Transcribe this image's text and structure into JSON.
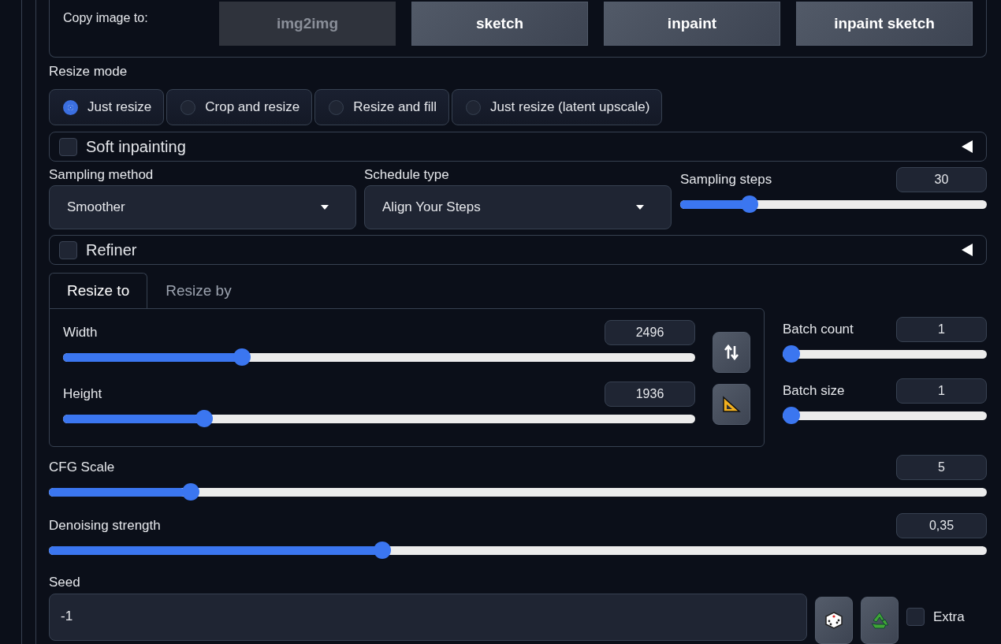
{
  "copy_panel": {
    "label": "Copy image to:",
    "buttons": [
      {
        "label": "img2img",
        "disabled": true
      },
      {
        "label": "sketch",
        "disabled": false
      },
      {
        "label": "inpaint",
        "disabled": false
      },
      {
        "label": "inpaint sketch",
        "disabled": false
      }
    ]
  },
  "resize_mode": {
    "label": "Resize mode",
    "options": [
      {
        "label": "Just resize",
        "selected": true
      },
      {
        "label": "Crop and resize",
        "selected": false
      },
      {
        "label": "Resize and fill",
        "selected": false
      },
      {
        "label": "Just resize (latent upscale)",
        "selected": false
      }
    ]
  },
  "soft_inpainting": {
    "label": "Soft inpainting",
    "checked": false,
    "expanded": false
  },
  "sampling_method": {
    "label": "Sampling method",
    "value": "Smoother"
  },
  "schedule_type": {
    "label": "Schedule type",
    "value": "Align Your Steps"
  },
  "sampling_steps": {
    "label": "Sampling steps",
    "value": "30",
    "level": 0.21
  },
  "refiner": {
    "label": "Refiner",
    "checked": false,
    "expanded": false
  },
  "size_tabs": [
    {
      "label": "Resize to",
      "selected": true
    },
    {
      "label": "Resize by",
      "selected": false
    }
  ],
  "width": {
    "label": "Width",
    "value": "2496",
    "level": 0.277
  },
  "height": {
    "label": "Height",
    "value": "1936",
    "level": 0.216
  },
  "batch_count": {
    "label": "Batch count",
    "value": "1",
    "level": 0
  },
  "batch_size": {
    "label": "Batch size",
    "value": "1",
    "level": 0
  },
  "cfg_scale": {
    "label": "CFG Scale",
    "value": "5",
    "level": 0.145
  },
  "denoising_strength": {
    "label": "Denoising strength",
    "value": "0,35",
    "level": 0.353
  },
  "seed": {
    "label": "Seed",
    "value": "-1"
  },
  "extra": {
    "label": "Extra",
    "checked": false
  }
}
